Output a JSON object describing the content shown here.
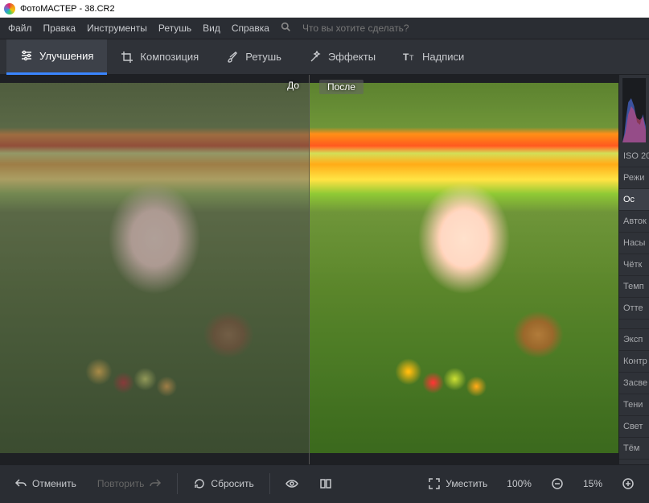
{
  "window": {
    "title": "ФотоМАСТЕР - 38.CR2"
  },
  "menu": {
    "file": "Файл",
    "edit": "Правка",
    "tools": "Инструменты",
    "retouch": "Ретушь",
    "view": "Вид",
    "help": "Справка",
    "search_placeholder": "Что вы хотите сделать?"
  },
  "toolbar": {
    "enhance": "Улучшения",
    "composition": "Композиция",
    "retouch": "Ретушь",
    "effects": "Эффекты",
    "text": "Надписи"
  },
  "viewer": {
    "before": "До",
    "after": "После"
  },
  "side": {
    "iso": "ISO 20",
    "mode": "Режи",
    "main": "Ос",
    "auto": "Авток",
    "saturation": "Насы",
    "sharpness": "Чётк",
    "temperature": "Темп",
    "tint": "Отте",
    "exposure": "Эксп",
    "contrast": "Контр",
    "highlights": "Засве",
    "shadows": "Тени",
    "whites": "Свет",
    "blacks": "Тём"
  },
  "bottom": {
    "undo": "Отменить",
    "redo": "Повторить",
    "reset": "Сбросить",
    "fit": "Уместить",
    "zoom1": "100%",
    "zoom2": "15%"
  }
}
